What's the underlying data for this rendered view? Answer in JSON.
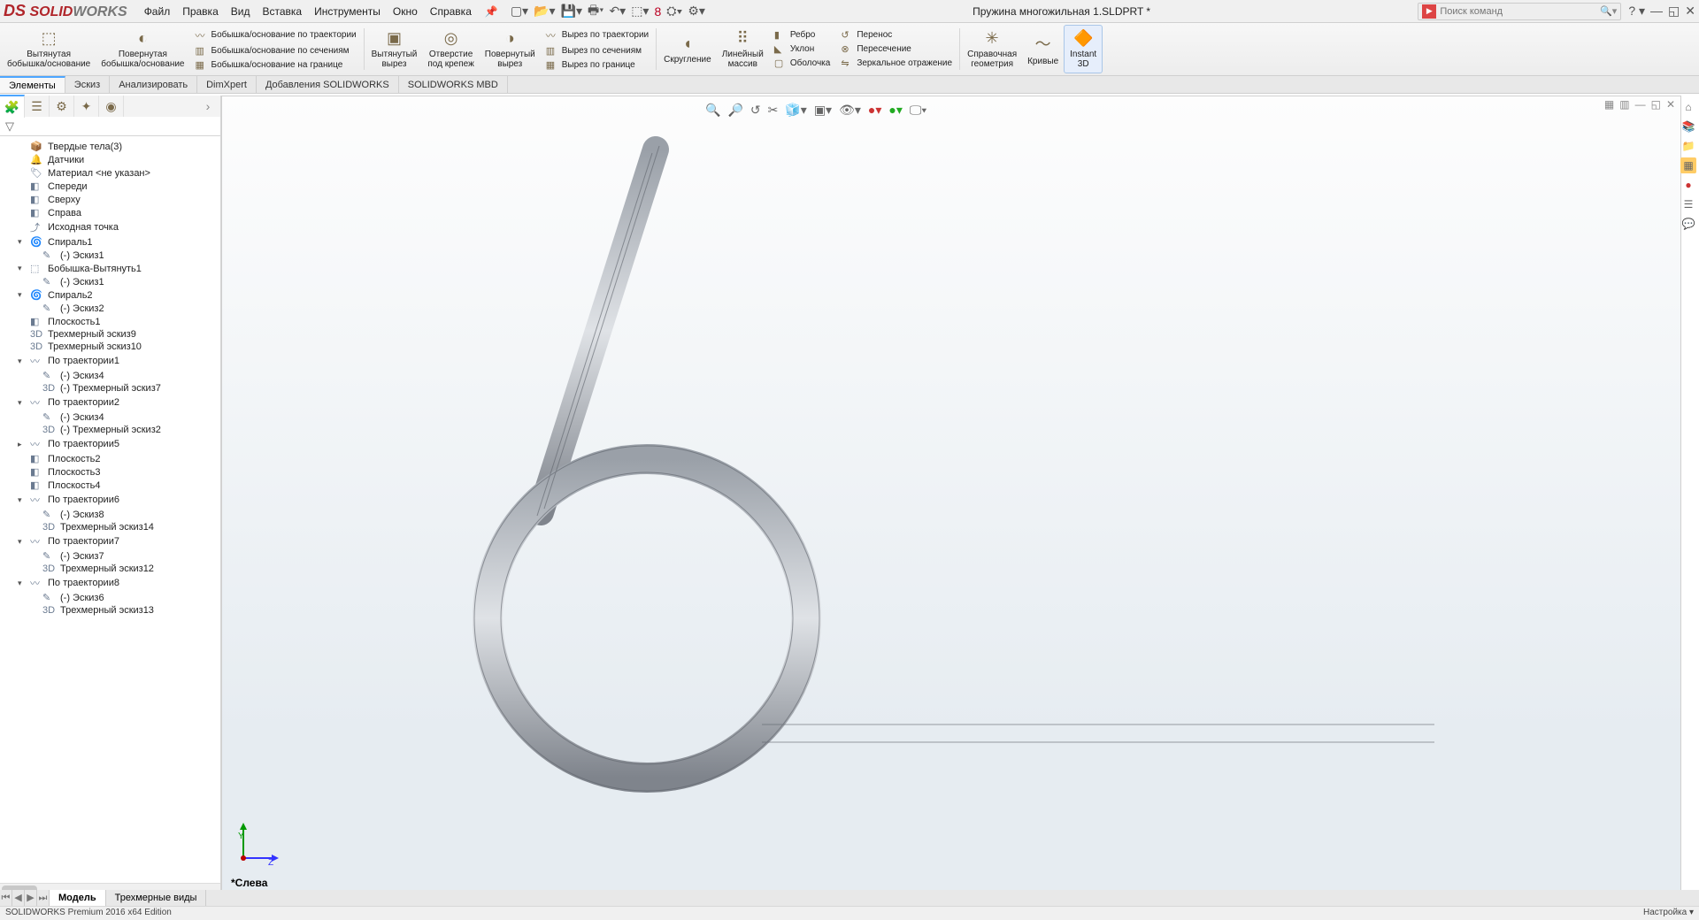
{
  "app": {
    "logo_ds": "DS",
    "logo_solid": " SOLID",
    "logo_works": "WORKS",
    "menus": [
      "Файл",
      "Правка",
      "Вид",
      "Вставка",
      "Инструменты",
      "Окно",
      "Справка"
    ],
    "doc_title": "Пружина многожильная 1.SLDPRT *",
    "search_placeholder": "Поиск команд"
  },
  "ribbon": {
    "big": [
      {
        "label": "Вытянутая\nбобышка/основание"
      },
      {
        "label": "Повернутая\nбобышка/основание"
      }
    ],
    "col1": [
      "Бобышка/основание по траектории",
      "Бобышка/основание по сечениям",
      "Бобышка/основание на границе"
    ],
    "big2": [
      {
        "label": "Вытянутый\nвырез"
      },
      {
        "label": "Отверстие\nпод крепеж"
      },
      {
        "label": "Повернутый\nвырез"
      }
    ],
    "col2": [
      "Вырез по траектории",
      "Вырез по сечениям",
      "Вырез по границе"
    ],
    "big3": [
      {
        "label": "Скругление"
      },
      {
        "label": "Линейный\nмассив"
      }
    ],
    "col3": [
      "Ребро",
      "Уклон",
      "Оболочка"
    ],
    "col4": [
      "Перенос",
      "Пересечение",
      "Зеркальное отражение"
    ],
    "big4": [
      {
        "label": "Справочная\nгеометрия"
      },
      {
        "label": "Кривые"
      },
      {
        "label": "Instant\n3D"
      }
    ]
  },
  "tabs": [
    "Элементы",
    "Эскиз",
    "Анализировать",
    "DimXpert",
    "Добавления SOLIDWORKS",
    "SOLIDWORKS MBD"
  ],
  "tree": [
    {
      "lvl": 1,
      "tw": "",
      "ic": "📦",
      "t": "Твердые тела(3)"
    },
    {
      "lvl": 1,
      "tw": "",
      "ic": "🔔",
      "t": "Датчики"
    },
    {
      "lvl": 1,
      "tw": "",
      "ic": "🏷",
      "t": "Материал <не указан>"
    },
    {
      "lvl": 1,
      "tw": "",
      "ic": "◧",
      "t": "Спереди"
    },
    {
      "lvl": 1,
      "tw": "",
      "ic": "◧",
      "t": "Сверху"
    },
    {
      "lvl": 1,
      "tw": "",
      "ic": "◧",
      "t": "Справа"
    },
    {
      "lvl": 1,
      "tw": "",
      "ic": "⤴",
      "t": "Исходная точка"
    },
    {
      "lvl": 1,
      "tw": "▾",
      "ic": "🌀",
      "t": "Спираль1"
    },
    {
      "lvl": 2,
      "tw": "",
      "ic": "✎",
      "t": "(-) Эскиз1"
    },
    {
      "lvl": 1,
      "tw": "▾",
      "ic": "⬚",
      "t": "Бобышка-Вытянуть1"
    },
    {
      "lvl": 2,
      "tw": "",
      "ic": "✎",
      "t": "(-) Эскиз1"
    },
    {
      "lvl": 1,
      "tw": "▾",
      "ic": "🌀",
      "t": "Спираль2"
    },
    {
      "lvl": 2,
      "tw": "",
      "ic": "✎",
      "t": "(-) Эскиз2"
    },
    {
      "lvl": 1,
      "tw": "",
      "ic": "◧",
      "t": "Плоскость1"
    },
    {
      "lvl": 1,
      "tw": "",
      "ic": "3D",
      "t": "Трехмерный эскиз9"
    },
    {
      "lvl": 1,
      "tw": "",
      "ic": "3D",
      "t": "Трехмерный эскиз10"
    },
    {
      "lvl": 1,
      "tw": "▾",
      "ic": "〰",
      "t": "По траектории1"
    },
    {
      "lvl": 2,
      "tw": "",
      "ic": "✎",
      "t": "(-) Эскиз4"
    },
    {
      "lvl": 2,
      "tw": "",
      "ic": "3D",
      "t": "(-) Трехмерный эскиз7"
    },
    {
      "lvl": 1,
      "tw": "▾",
      "ic": "〰",
      "t": "По траектории2"
    },
    {
      "lvl": 2,
      "tw": "",
      "ic": "✎",
      "t": "(-) Эскиз4"
    },
    {
      "lvl": 2,
      "tw": "",
      "ic": "3D",
      "t": "(-) Трехмерный эскиз2"
    },
    {
      "lvl": 1,
      "tw": "▸",
      "ic": "〰",
      "t": "По траектории5"
    },
    {
      "lvl": 1,
      "tw": "",
      "ic": "◧",
      "t": "Плоскость2"
    },
    {
      "lvl": 1,
      "tw": "",
      "ic": "◧",
      "t": "Плоскость3"
    },
    {
      "lvl": 1,
      "tw": "",
      "ic": "◧",
      "t": "Плоскость4"
    },
    {
      "lvl": 1,
      "tw": "▾",
      "ic": "〰",
      "t": "По траектории6"
    },
    {
      "lvl": 2,
      "tw": "",
      "ic": "✎",
      "t": "(-) Эскиз8"
    },
    {
      "lvl": 2,
      "tw": "",
      "ic": "3D",
      "t": "Трехмерный эскиз14"
    },
    {
      "lvl": 1,
      "tw": "▾",
      "ic": "〰",
      "t": "По траектории7"
    },
    {
      "lvl": 2,
      "tw": "",
      "ic": "✎",
      "t": "(-) Эскиз7"
    },
    {
      "lvl": 2,
      "tw": "",
      "ic": "3D",
      "t": "Трехмерный эскиз12"
    },
    {
      "lvl": 1,
      "tw": "▾",
      "ic": "〰",
      "t": "По траектории8"
    },
    {
      "lvl": 2,
      "tw": "",
      "ic": "✎",
      "t": "(-) Эскиз6"
    },
    {
      "lvl": 2,
      "tw": "",
      "ic": "3D",
      "t": "Трехмерный эскиз13"
    }
  ],
  "view": {
    "label": "*Слева",
    "y": "Y",
    "z": "Z"
  },
  "doctabs": {
    "active": "Модель",
    "other": "Трехмерные виды"
  },
  "status": {
    "left": "SOLIDWORKS Premium 2016 x64 Edition",
    "right": "Настройка ▾"
  }
}
